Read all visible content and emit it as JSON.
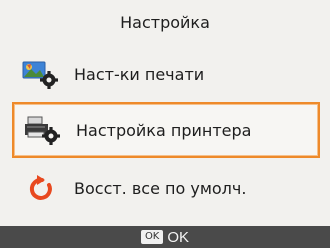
{
  "screen": {
    "title": "Настройка"
  },
  "menu": {
    "items": [
      {
        "label": "Наст-ки печати",
        "icon": "photo-gear-icon",
        "selected": false
      },
      {
        "label": "Настройка принтера",
        "icon": "printer-gear-icon",
        "selected": true
      },
      {
        "label": "Восст. все по умолч.",
        "icon": "reset-arrow-icon",
        "selected": false
      }
    ]
  },
  "footer": {
    "key_label": "OK",
    "action_label": "OK"
  },
  "colors": {
    "accent": "#ee8a2a",
    "footer_bg": "#4a4a4a",
    "reset_icon": "#e8491f"
  }
}
